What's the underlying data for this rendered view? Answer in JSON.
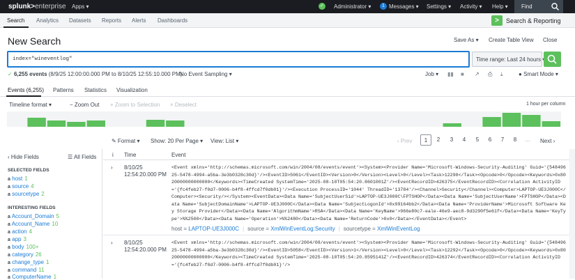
{
  "topbar": {
    "logo_bold": "splunk>",
    "logo_rest": "enterprise",
    "apps": "Apps ▾",
    "administrator": "Administrator ▾",
    "messages_count": "1",
    "messages": "Messages ▾",
    "settings": "Settings ▾",
    "activity": "Activity ▾",
    "help": "Help ▾",
    "find": "Find"
  },
  "appbar": {
    "tabs": [
      "Search",
      "Analytics",
      "Datasets",
      "Reports",
      "Alerts",
      "Dashboards"
    ],
    "brand": "Search & Reporting"
  },
  "header": {
    "title": "New Search",
    "save_as": "Save As ▾",
    "create_table_view": "Create Table View",
    "close": "Close"
  },
  "search": {
    "query": "index=\"wineventlog\"",
    "time_range": "Time range: Last 24 hours ▾"
  },
  "status": {
    "events_count": "6,255 events",
    "range": "(8/9/25 12:00:00.000 PM to 8/10/25 12:55:10.000 PM)",
    "sampling": "No Event Sampling ▾",
    "job": "Job ▾",
    "smart_mode": "Smart Mode ▾"
  },
  "tabs": [
    "Events (6,255)",
    "Patterns",
    "Statistics",
    "Visualization"
  ],
  "timeline": {
    "format": "Timeline format ▾",
    "zoom_out": "− Zoom Out",
    "zoom_sel": "+ Zoom to Selection",
    "deselect": "× Deselect",
    "scale": "1 hour per column",
    "bars": [
      0,
      0.65,
      0.45,
      0.35,
      0.45,
      0,
      0,
      0.5,
      0.45,
      0,
      0,
      0,
      0,
      0,
      0,
      0,
      0,
      0,
      0,
      0,
      0,
      0,
      0.25,
      0,
      0.7,
      1.0,
      0.85,
      0.4
    ]
  },
  "pager": {
    "format": "✎ Format ▾",
    "per_page": "Show: 20 Per Page ▾",
    "view": "View: List ▾",
    "prev": "‹ Prev",
    "pages": [
      "1",
      "2",
      "3",
      "4",
      "5",
      "6",
      "7",
      "8",
      "..."
    ],
    "next": "Next ›"
  },
  "sidebar": {
    "hide_fields": "‹ Hide Fields",
    "all_fields": "☰ All Fields",
    "selected_title": "SELECTED FIELDS",
    "selected": [
      {
        "type": "a",
        "name": "host",
        "count": "1"
      },
      {
        "type": "a",
        "name": "source",
        "count": "4"
      },
      {
        "type": "a",
        "name": "sourcetype",
        "count": "2"
      }
    ],
    "interesting_title": "INTERESTING FIELDS",
    "interesting": [
      {
        "type": "a",
        "name": "Account_Domain",
        "count": "5"
      },
      {
        "type": "a",
        "name": "Account_Name",
        "count": "10"
      },
      {
        "type": "a",
        "name": "action",
        "count": "4"
      },
      {
        "type": "a",
        "name": "app",
        "count": "3"
      },
      {
        "type": "a",
        "name": "body",
        "count": "100+"
      },
      {
        "type": "a",
        "name": "category",
        "count": "26"
      },
      {
        "type": "a",
        "name": "change_type",
        "count": "1"
      },
      {
        "type": "a",
        "name": "command",
        "count": "11"
      },
      {
        "type": "a",
        "name": "ComputerName",
        "count": "1"
      }
    ]
  },
  "events": {
    "col_i": "i",
    "col_time": "Time",
    "col_event": "Event",
    "rows": [
      {
        "date": "8/10/25",
        "time": "12:54:20.000 PM",
        "raw": "<Event xmlns='http://schemas.microsoft.com/win/2004/08/events/event'><System><Provider Name='Microsoft-Windows-Security-Auditing' Guid='{54849625-5478-4994-a5ba-3e3b0328c30d}'/><EventID>5061</EventID><Version>0</Version><Level>0</Level><Task>12290</Task><Opcode>0</Opcode><Keywords>0x8020000000000000</Keywords><TimeCreated SystemTime='2025-08-10T05:54:20.8601001Z'/><EventRecordID>426375</EventRecordID><Correlation ActivityID='{fc4feb27-f0d7-0006-b4f8-4ffcd7f0db01}'/><Execution ProcessID='1044' ThreadID='13784'/><Channel>Security</Channel><Computer>LAPTOP-UE3J000C</Computer><Security/></System><EventData><Data Name='SubjectUserSid'>LAPTOP-UE3J000C\\FPTSHOP</Data><Data Name='SubjectUserName'>FPTSHOP</Data><Data Name='SubjectDomainName'>LAPTOP-UE3J000C</Data><Data Name='SubjectLogonId'>0x99164bb2</Data><Data Name='ProviderName'>Microsoft Software Key Storage Provider</Data><Data Name='AlgorithmName'>RSA</Data><Data Name='KeyName'>966e80c7-eale-46e9-aec8-9d3290f5e61f</Data><Data Name='KeyType'>%%2500</Data><Data Name='Operation'>%%2480</Data><Data Name='ReturnCode'>0x0</Data></EventData></Event>",
        "host": "LAPTOP-UE3J000C",
        "source": "XmlWinEventLog:Security",
        "sourcetype": "XmlWinEventLog"
      },
      {
        "date": "8/10/25",
        "time": "12:54:20.000 PM",
        "raw": "<Event xmlns='http://schemas.microsoft.com/win/2004/08/events/event'><System><Provider Name='Microsoft-Windows-Security-Auditing' Guid='{54849625-5478-4994-a5ba-3e3b0328c30d}'/><EventID>5058</EventID><Version>1</Version><Level>0</Level><Task>12292</Task><Opcode>0</Opcode><Keywords>0x8020000000000000</Keywords><TimeCreated SystemTime='2025-08-10T05:54:20.8595141Z'/><EventRecordID>426374</EventRecordID><Correlation ActivityID='{fc4feb27-f0d7-0006-b4f8-4ffcd7f0db01}'/>"
      }
    ],
    "meta_host": "host =",
    "meta_source": "source =",
    "meta_sourcetype": "sourcetype ="
  },
  "colors": {
    "accent_green": "#5cc05c",
    "accent_blue": "#1a7bd6",
    "topbar_bg": "#1a1c21"
  }
}
